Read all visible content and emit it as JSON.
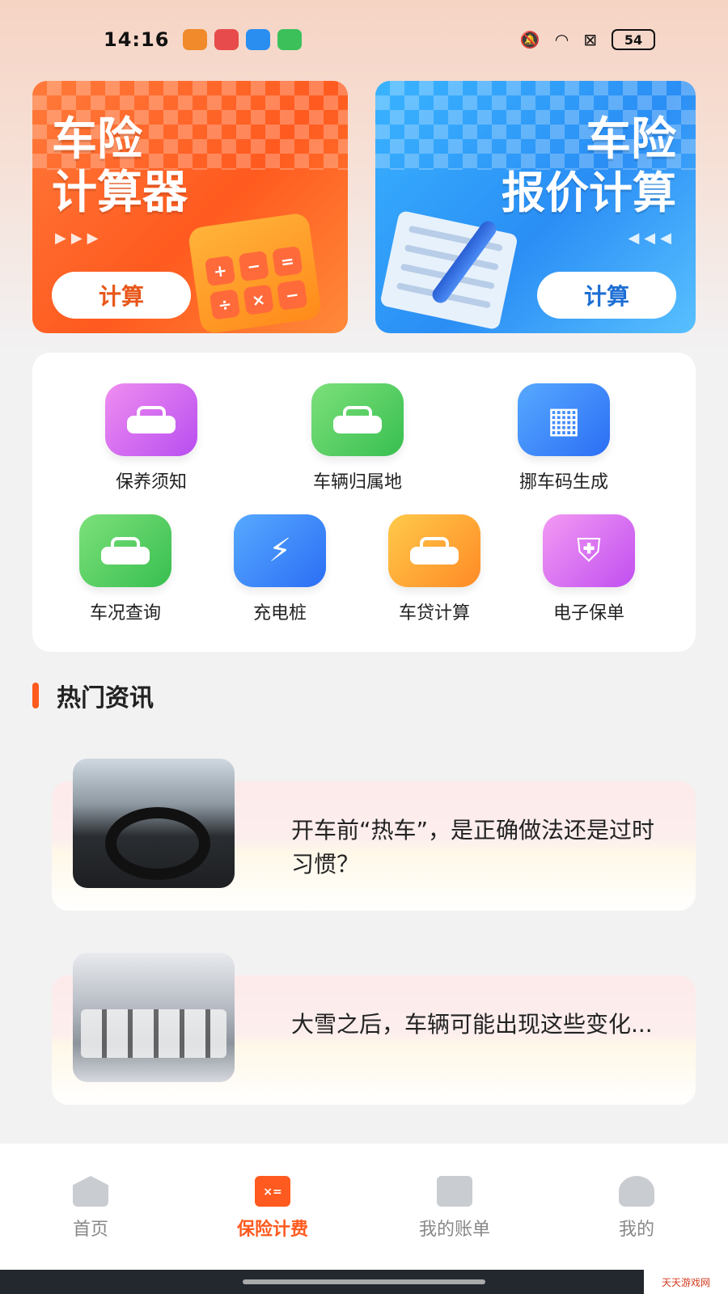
{
  "status_bar": {
    "time": "14:16",
    "battery": "54"
  },
  "banners": [
    {
      "title_line1": "车险",
      "title_line2": "计算器",
      "button": "计算",
      "color": "#ff5a1f"
    },
    {
      "title_line1": "车险",
      "title_line2": "报价计算",
      "button": "计算",
      "color": "#2a8ef5"
    }
  ],
  "tools": [
    {
      "label": "保养须知",
      "icon": "car-tag-icon"
    },
    {
      "label": "车辆归属地",
      "icon": "car-location-icon"
    },
    {
      "label": "挪车码生成",
      "icon": "qr-code-icon"
    },
    {
      "label": "车况查询",
      "icon": "car-search-icon"
    },
    {
      "label": "充电桩",
      "icon": "charging-pile-icon"
    },
    {
      "label": "车贷计算",
      "icon": "car-loan-icon"
    },
    {
      "label": "电子保单",
      "icon": "shield-steering-icon"
    }
  ],
  "news_section": {
    "title": "热门资讯",
    "accent": "#ff5a1f"
  },
  "news": [
    {
      "title": "开车前“热车”，是正确做法还是过时习惯？"
    },
    {
      "title": "大雪之后，车辆可能出现这些变化..."
    }
  ],
  "tabs": [
    {
      "label": "首页",
      "icon": "home-icon"
    },
    {
      "label": "保险计费",
      "icon": "calculator-icon",
      "active": true
    },
    {
      "label": "我的账单",
      "icon": "bill-icon"
    },
    {
      "label": "我的",
      "icon": "user-icon"
    }
  ],
  "watermark": "天天游戏网"
}
